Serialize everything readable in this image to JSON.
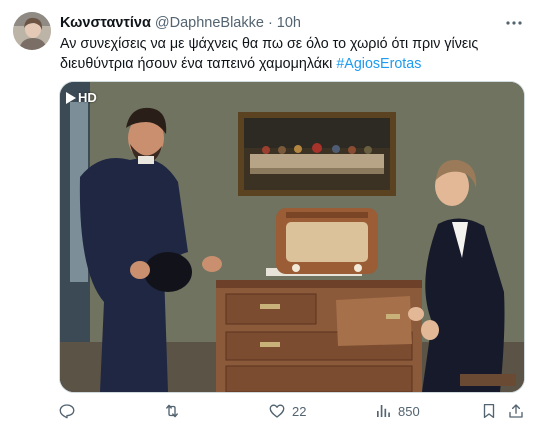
{
  "tweet": {
    "author_name": "Κωνσταντίνα",
    "handle": "@DaphneBlakke",
    "separator": "·",
    "time": "10h",
    "text_main": "Αν συνεχίσεις να με ψάχνεις θα πω σε όλο το χωριό ότι πριν γίνεις διευθύντρια ήσουν ένα ταπεινό χαμομηλάκι ",
    "hashtag": "#AgiosErotas",
    "media_badge": "HD"
  },
  "actions": {
    "likes": "22",
    "views": "850"
  },
  "icons": {
    "more": "more-horizontal-icon",
    "reply": "reply-icon",
    "retweet": "retweet-icon",
    "like": "heart-icon",
    "views": "views-chart-icon",
    "bookmark": "bookmark-icon",
    "share": "share-icon"
  },
  "colors": {
    "text": "#0f1419",
    "secondary": "#536471",
    "accent": "#1d9bf0"
  }
}
